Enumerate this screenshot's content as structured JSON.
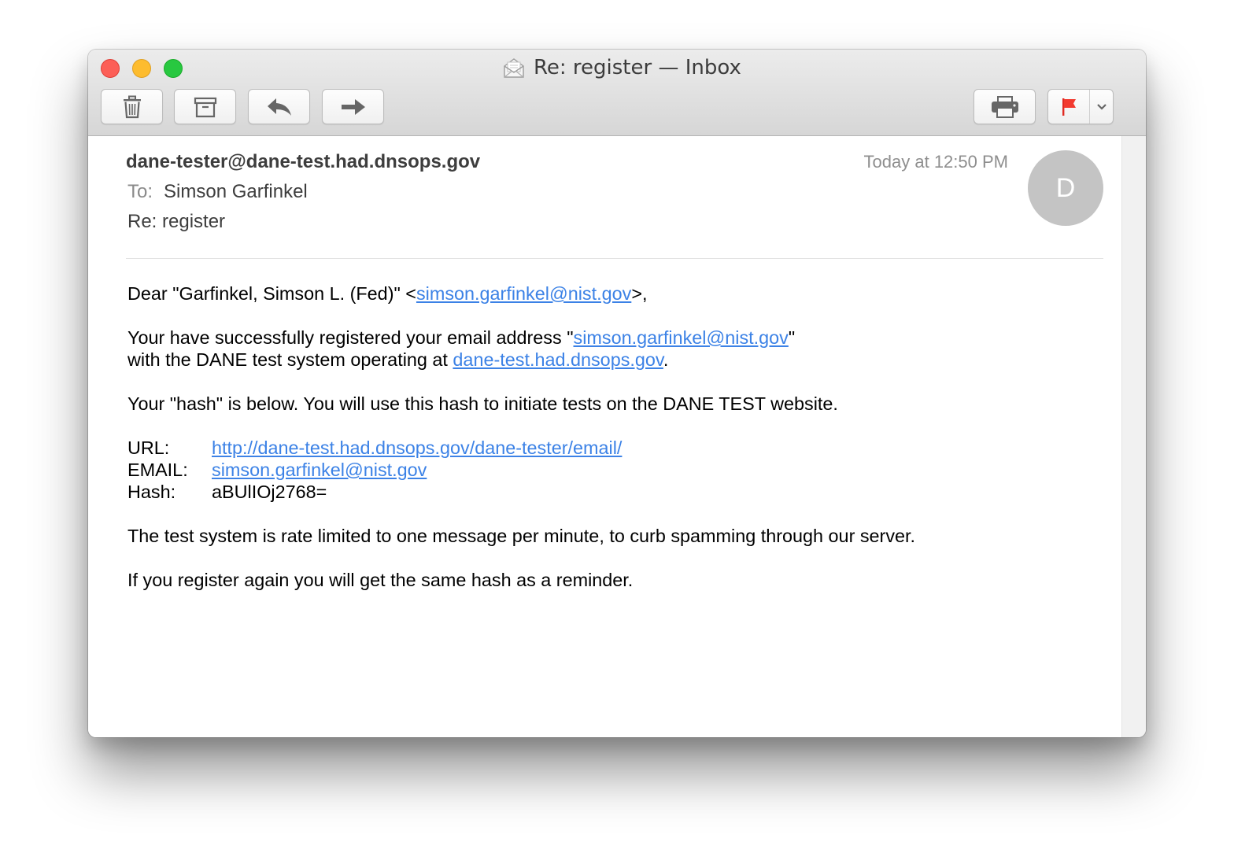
{
  "window": {
    "title": "Re: register — Inbox"
  },
  "toolbar": {
    "trash_icon": "trash-icon",
    "archive_icon": "archive-icon",
    "reply_icon": "reply-icon",
    "forward_icon": "forward-icon",
    "print_icon": "print-icon",
    "flag_icon": "flag-icon",
    "flag_color": "#f23a2f"
  },
  "header": {
    "from": "dane-tester@dane-test.had.dnsops.gov",
    "to_label": "To:",
    "to_name": "Simson Garfinkel",
    "subject": "Re: register",
    "date": "Today at 12:50 PM",
    "avatar_initial": "D"
  },
  "message": {
    "greeting_prefix": "Dear \"Garfinkel, Simson L. (Fed)\" <",
    "greeting_link": "simson.garfinkel@nist.gov",
    "greeting_suffix": ">,",
    "p2_prefix": "Your have successfully registered your email address \"",
    "p2_link": "simson.garfinkel@nist.gov",
    "p2_suffix": "\"",
    "p2_line2_prefix": "with the DANE test system operating at ",
    "p2_line2_link": "dane-test.had.dnsops.gov",
    "p2_line2_suffix": ".",
    "p3": "Your \"hash\" is below. You will use this hash to initiate tests on the DANE TEST website.",
    "url_label": "URL:",
    "url_value": "http://dane-test.had.dnsops.gov/dane-tester/email/",
    "email_label": "EMAIL:",
    "email_value": "simson.garfinkel@nist.gov",
    "hash_label": "Hash:",
    "hash_value": "aBUlIOj2768=",
    "p5": "The test system is rate limited to one message per minute, to curb spamming through our server.",
    "p6": "If you register again you will get the same hash as a reminder."
  },
  "colors": {
    "link": "#3c82e6",
    "close": "#fc5f57",
    "minimize": "#fdbc2e",
    "maximize": "#28c840",
    "avatar": "#c4c4c4"
  }
}
